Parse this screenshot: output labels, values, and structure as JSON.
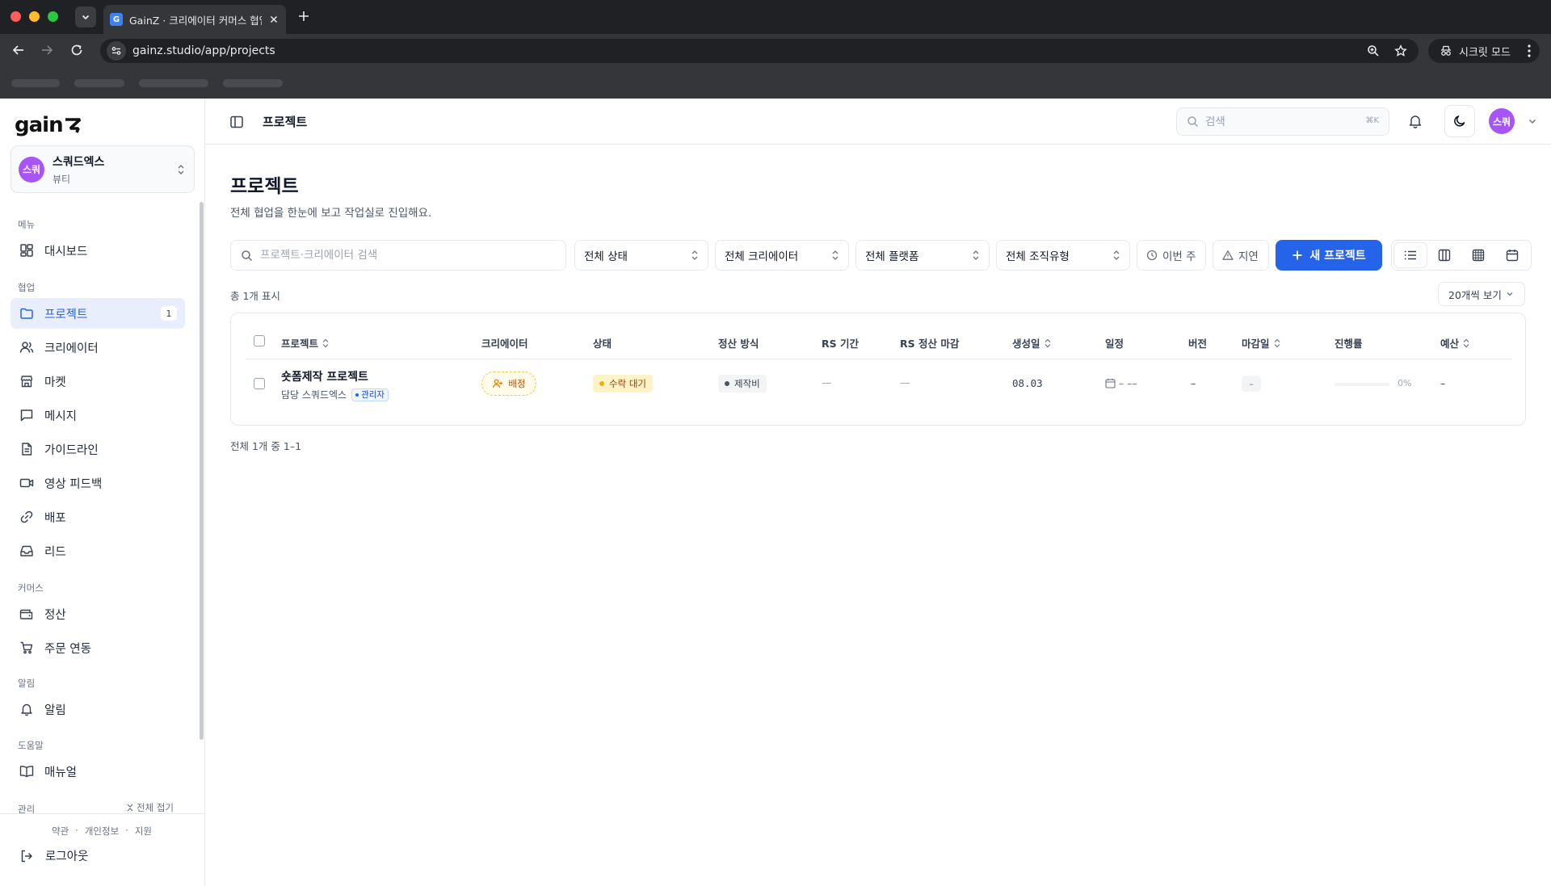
{
  "browser": {
    "tab_title": "GainZ · 크리에이터 커머스 협업 C",
    "tab_favicon": "G",
    "url": "gainz.studio/app/projects",
    "incognito_label": "시크릿 모드"
  },
  "sidebar": {
    "logo": "gain",
    "org": {
      "avatar": "스쿼",
      "name": "스쿼드엑스",
      "category": "뷰티"
    },
    "sections": {
      "menu": "메뉴",
      "collab": "협업",
      "commerce": "커머스",
      "alerts": "알림",
      "help": "도움말",
      "admin": "관리"
    },
    "items": {
      "dashboard": "대시보드",
      "projects": "프로젝트",
      "projects_badge": "1",
      "creators": "크리에이터",
      "market": "마켓",
      "messages": "메시지",
      "guidelines": "가이드라인",
      "video_feedback": "영상 피드백",
      "distribution": "배포",
      "leads": "리드",
      "settlement": "정산",
      "order_sync": "주문 연동",
      "notifications": "알림",
      "manual": "매뉴얼"
    },
    "collapse_all": "전체 접기",
    "footer": {
      "terms": "약관",
      "privacy": "개인정보",
      "support": "지원",
      "sep": "·",
      "logout": "로그아웃"
    }
  },
  "topbar": {
    "title": "프로젝트",
    "search_placeholder": "검색",
    "search_shortcut": "⌘K",
    "user_avatar": "스쿼"
  },
  "page": {
    "title": "프로젝트",
    "subtitle": "전체 협업을 한눈에 보고 작업실로 진입해요.",
    "filters": {
      "search_placeholder": "프로젝트·크리에이터 검색",
      "status": "전체 상태",
      "creator": "전체 크리에이터",
      "platform": "전체 플랫폼",
      "org_type": "전체 조직유형",
      "this_week": "이번 주",
      "delayed": "지연"
    },
    "new_button": "새 프로젝트",
    "count_label": "총 1개 표시",
    "per_page": "20개씩 보기",
    "pager": "전체 1개 중 1–1"
  },
  "table": {
    "columns": {
      "project": "프로젝트",
      "creator": "크리에이터",
      "status": "상태",
      "settlement": "정산 방식",
      "rs_period": "RS 기간",
      "rs_deadline": "RS 정산 마감",
      "created": "생성일",
      "schedule": "일정",
      "version": "버전",
      "deadline": "마감일",
      "progress": "진행률",
      "budget": "예산"
    },
    "rows": [
      {
        "name": "숏폼제작 프로젝트",
        "owner": "담당 스쿼드엑스",
        "role": "관리자",
        "creator": "배정",
        "status": "수락 대기",
        "settlement": "제작비",
        "rs_period": "—",
        "rs_deadline": "—",
        "created": "08.03",
        "schedule": "– ––",
        "version": "–",
        "deadline": "–",
        "progress": 0,
        "progress_label": "0%",
        "budget": "–"
      }
    ]
  },
  "colors": {
    "accent": "#2563eb",
    "avatar": "#a855f7",
    "status_pending": "#eab308"
  }
}
